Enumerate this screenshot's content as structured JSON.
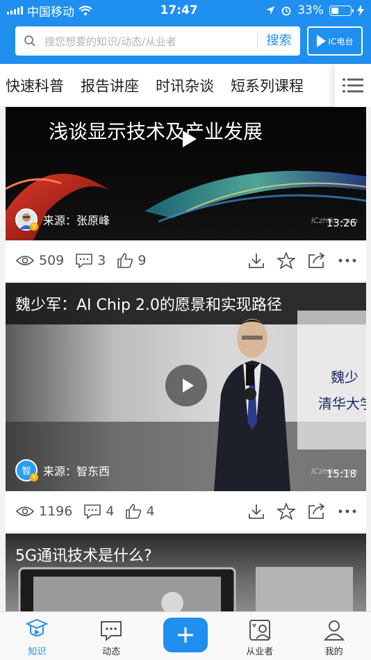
{
  "status": {
    "carrier": "中国移动",
    "time": "17:47",
    "battery": "33%"
  },
  "search": {
    "placeholder": "搜您想要的知识/动态/从业者",
    "button": "搜索",
    "radio_label": "IC电台"
  },
  "tabs": [
    "快速科普",
    "报告讲座",
    "时讯杂谈",
    "短系列课程"
  ],
  "cards": [
    {
      "title": "浅谈显示技术及产业发展",
      "source": "来源：张原峰",
      "duration": "13:26",
      "views": "509",
      "comments": "3",
      "likes": "9"
    },
    {
      "title": "魏少军：AI Chip 2.0的愿景和实现路径",
      "source": "来源：智东西",
      "duration": "15:18",
      "views": "1196",
      "comments": "4",
      "likes": "4",
      "overlay": [
        "魏少",
        "清华大学"
      ]
    },
    {
      "title": "5G通讯技术是什么?"
    }
  ],
  "watermark": "ICzhiku.com",
  "nav": {
    "knowledge": "知识",
    "dynamic": "动态",
    "practitioner": "从业者",
    "mine": "我的"
  },
  "colors": {
    "accent": "#1f8ff0"
  }
}
